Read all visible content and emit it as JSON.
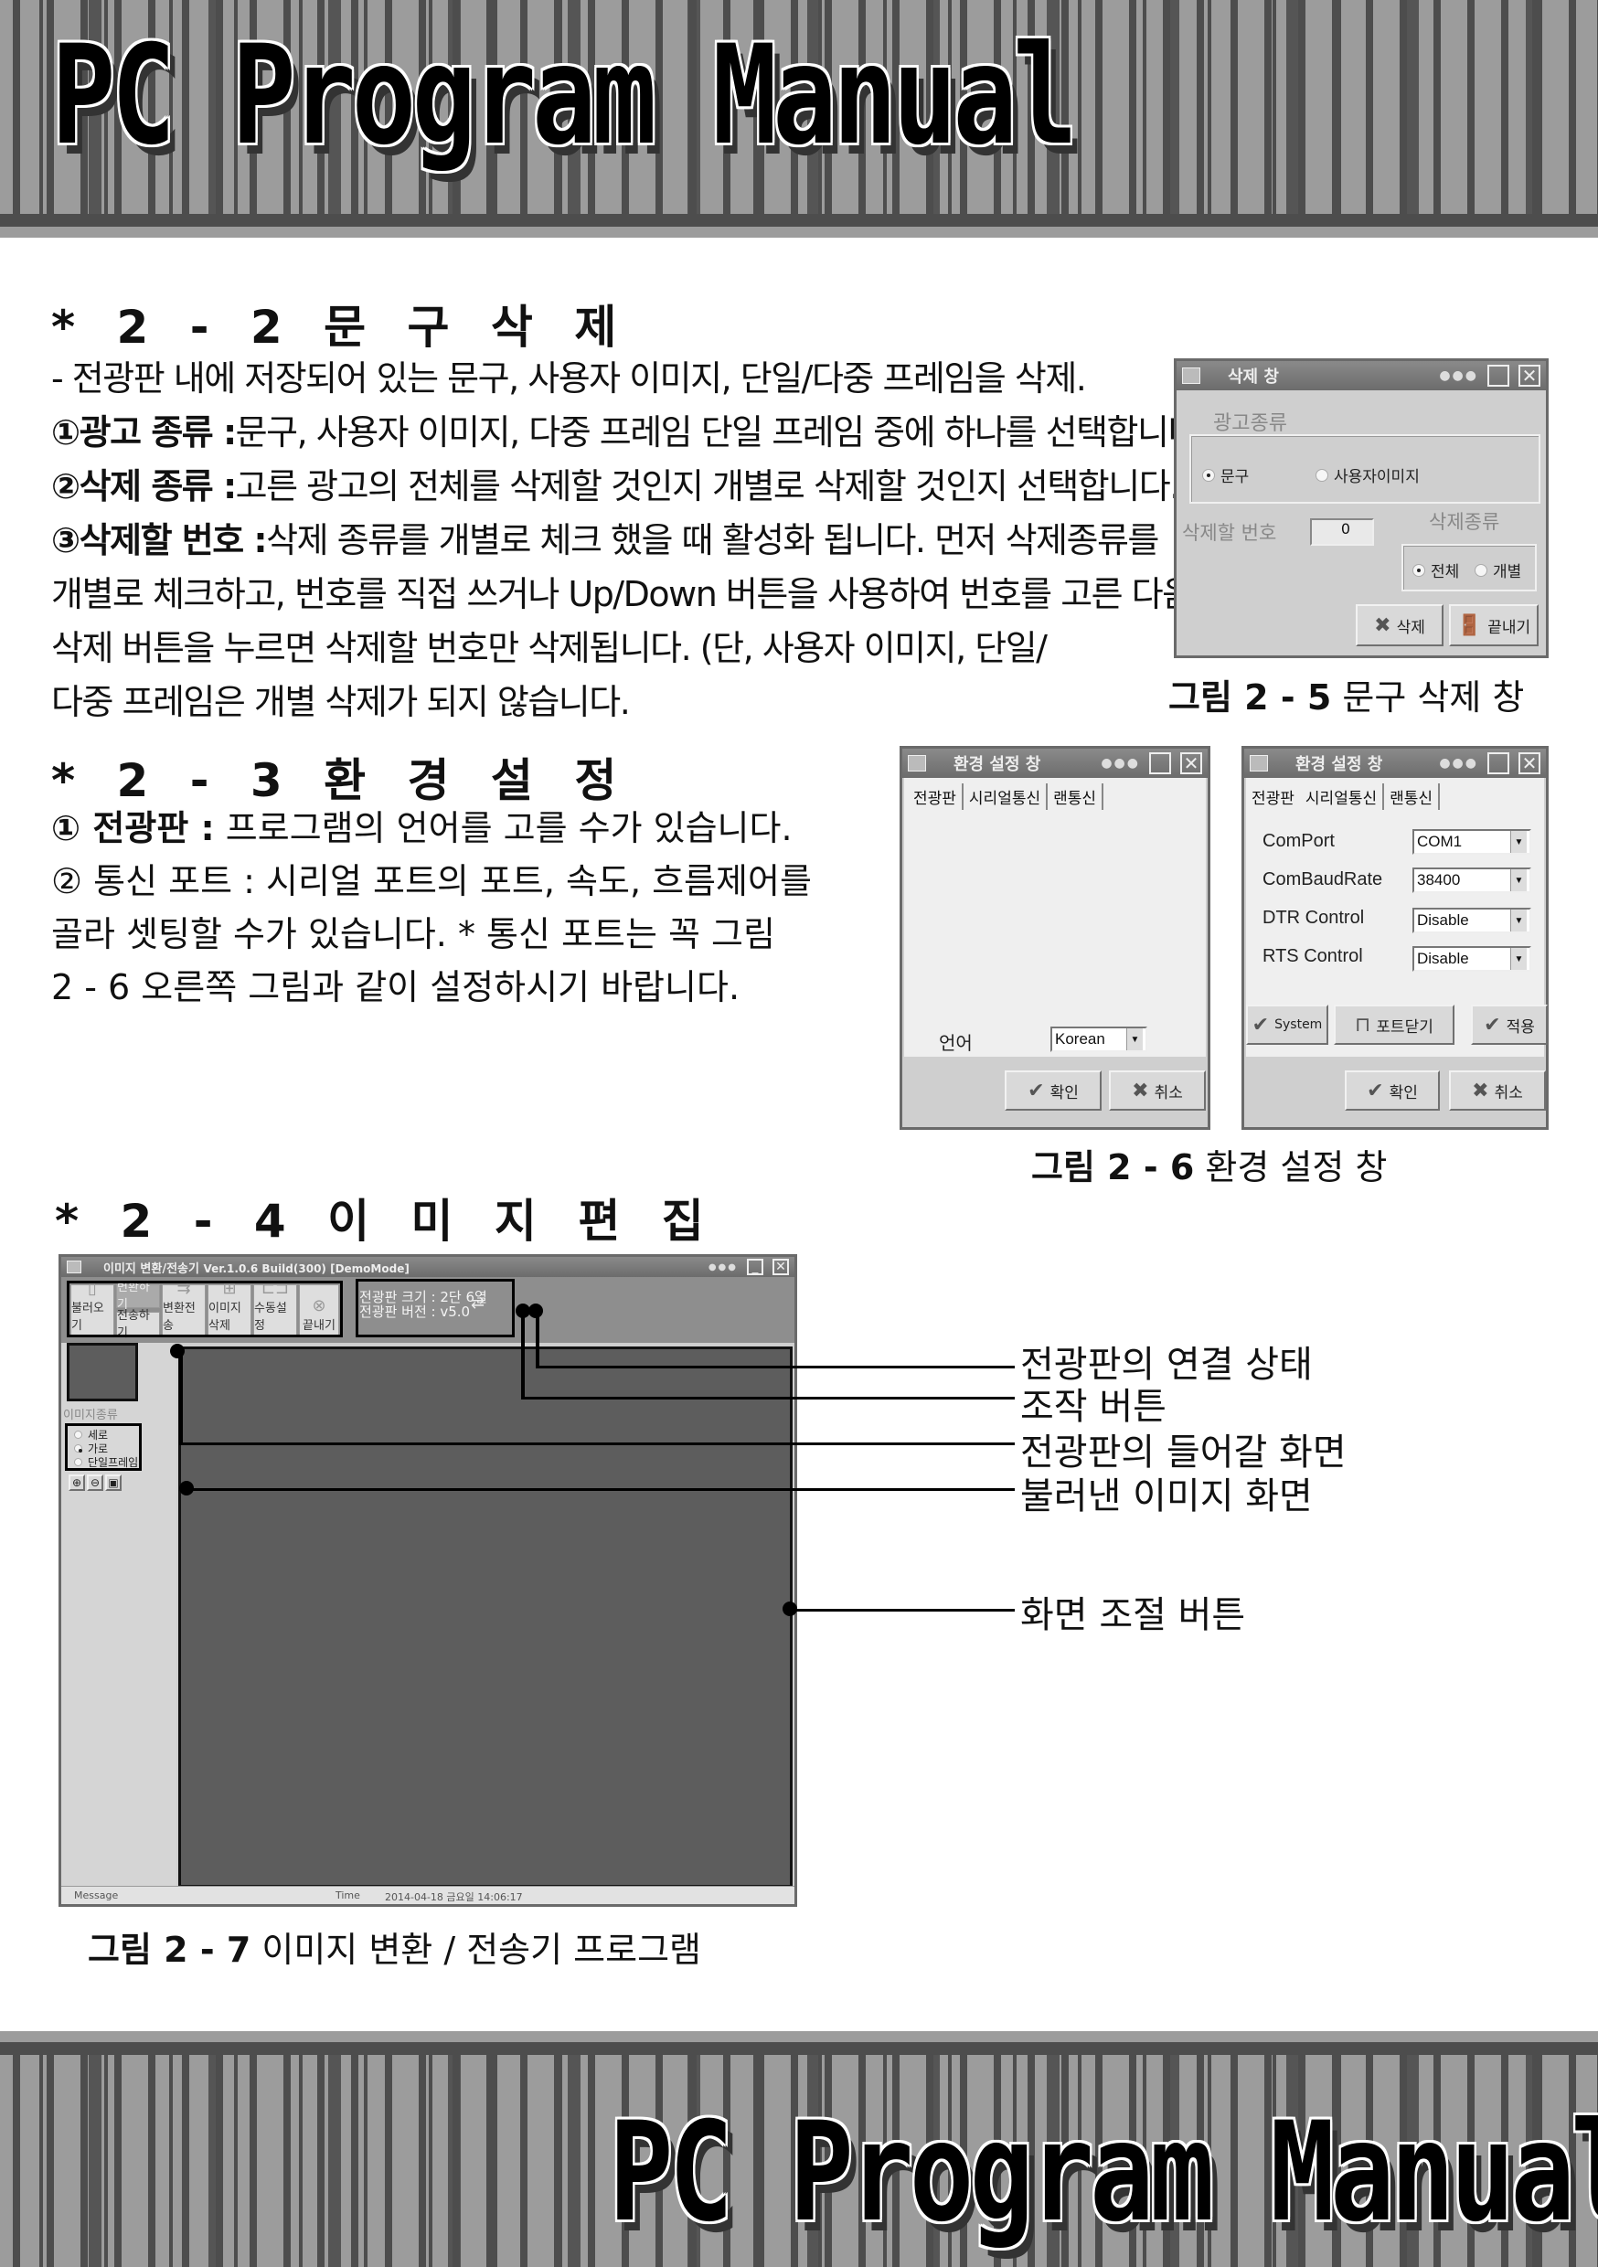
{
  "banner": {
    "title": "PC Program Manual"
  },
  "section_2_2": {
    "heading": "* 2 - 2  문 구 삭 제",
    "intro": "- 전광판 내에 저장되어 있는 문구, 사용자 이미지, 단일/다중 프레임을 삭제.",
    "items": [
      {
        "label": "①광고 종류 :",
        "text": "문구, 사용자 이미지, 다중 프레임 단일 프레임 중에 하나를 선택합니다."
      },
      {
        "label": "②삭제 종류 :",
        "text": "고른 광고의 전체를 삭제할 것인지 개별로 삭제할 것인지 선택합니다."
      },
      {
        "label": "③삭제할 번호 :",
        "text": "삭제 종류를 개별로 체크 했을 때 활성화 됩니다. 먼저 삭제종류를"
      }
    ],
    "continuation": [
      "개별로 체크하고, 번호를 직접 쓰거나 Up/Down 버튼을 사용하여 번호를 고른 다음",
      "삭제 버튼을 누르면 삭제할 번호만 삭제됩니다. (단, 사용자 이미지, 단일/",
      "다중 프레임은 개별 삭제가 되지 않습니다."
    ],
    "figure_label": "그림 2 - 5",
    "figure_caption": "문구 삭제 창"
  },
  "delete_window": {
    "title": "삭제 창",
    "ad_type_label": "광고종류",
    "ad_type_options": [
      {
        "label": "문구",
        "selected": true
      },
      {
        "label": "사용자이미지",
        "selected": false
      }
    ],
    "number_label": "삭제할 번호",
    "number_value": "0",
    "delete_type_label": "삭제종류",
    "delete_type_options": [
      {
        "label": "전체",
        "selected": true
      },
      {
        "label": "개별",
        "selected": false
      }
    ],
    "delete_button": "삭제",
    "exit_button": "끝내기"
  },
  "section_2_3": {
    "heading": "* 2 - 3  환 경 설 정",
    "item1_label": "① 전광판 :",
    "item1_text": " 프로그램의 언어를 고를 수가 있습니다.",
    "item2": "② 통신 포트 : 시리얼 포트의 포트, 속도, 흐름제어를",
    "lines": [
      "골라 셋팅할 수가 있습니다. * 통신 포트는 꼭 그림",
      "2 - 6 오른쪽 그림과 같이 설정하시기 바랍니다."
    ],
    "figure_label": "그림 2 - 6",
    "figure_caption": "환경 설정 창"
  },
  "settings_window_left": {
    "title": "환경 설정 창",
    "tabs": [
      "전광판",
      "시리얼통신",
      "랜통신"
    ],
    "active_tab": "전광판",
    "language_label": "언어",
    "language_value": "Korean",
    "ok_button": "확인",
    "cancel_button": "취소"
  },
  "settings_window_right": {
    "title": "환경 설정 창",
    "tabs": [
      "전광판",
      "시리얼통신",
      "랜통신"
    ],
    "active_tab": "시리얼통신",
    "fields": [
      {
        "label": "ComPort",
        "value": "COM1"
      },
      {
        "label": "ComBaudRate",
        "value": "38400"
      },
      {
        "label": "DTR Control",
        "value": "Disable"
      },
      {
        "label": "RTS Control",
        "value": "Disable"
      }
    ],
    "system_button": "System",
    "close_port_button": "포트닫기",
    "apply_button": "적용",
    "ok_button": "확인",
    "cancel_button": "취소"
  },
  "section_2_4": {
    "heading": "* 2 - 4  이 미 지  편 집",
    "figure_label": "그림 2 - 7",
    "figure_caption": "이미지 변환 / 전송기 프로그램"
  },
  "converter_app": {
    "title": "이미지 변환/전송기",
    "version": "Ver.1.0.6 Build(300) [DemoMode]",
    "toolbar": [
      "불러오기",
      "변환하기",
      "전송하기",
      "변환전송",
      "이미지삭제",
      "수동설정",
      "끝내기"
    ],
    "board_size": "전광판 크기 : 2단 6열",
    "board_version": "전광판 버전 : v5.0",
    "image_type_label": "이미지종류",
    "image_type_options": [
      {
        "label": "세로",
        "selected": false
      },
      {
        "label": "가로",
        "selected": true
      },
      {
        "label": "단일프레임",
        "selected": false
      }
    ],
    "status_message_label": "Message",
    "status_time_label": "Time",
    "status_time_value": "2014-04-18 금요일 14:06:17"
  },
  "callouts": [
    "전광판의 연결 상태",
    "조작 버튼",
    "전광판의 들어갈 화면",
    "불러낸 이미지 화면",
    "화면 조절 버튼"
  ]
}
